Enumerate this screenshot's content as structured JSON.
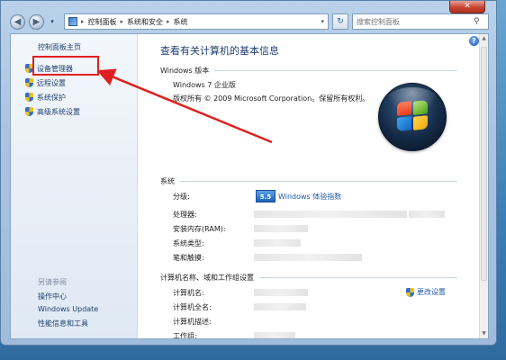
{
  "window": {
    "close_glyph": "✕"
  },
  "nav": {
    "back_glyph": "◀",
    "forward_glyph": "▶",
    "dropdown_glyph": "▾",
    "breadcrumb": [
      "控制面板",
      "系统和安全",
      "系统"
    ],
    "separator_glyph": "▸",
    "address_chevron": "▾",
    "refresh_glyph": "↻",
    "search_placeholder": "搜索控制面板",
    "search_icon_glyph": "⚲"
  },
  "sidebar": {
    "home": "控制面板主页",
    "items": [
      {
        "label": "设备管理器",
        "icon": "shield-icon"
      },
      {
        "label": "远程设置",
        "icon": "shield-icon"
      },
      {
        "label": "系统保护",
        "icon": "shield-icon"
      },
      {
        "label": "高级系统设置",
        "icon": "shield-icon"
      }
    ],
    "see_also": "另请参阅",
    "see_also_items": [
      "操作中心",
      "Windows Update",
      "性能信息和工具"
    ]
  },
  "main": {
    "help_glyph": "?",
    "title": "查看有关计算机的基本信息",
    "edition_section": "Windows 版本",
    "edition": "Windows 7 企业版",
    "copyright": "版权所有 © 2009 Microsoft Corporation。保留所有权利。",
    "system_section": "系统",
    "system_rows": [
      "分级:",
      "处理器:",
      "安装内存(RAM):",
      "系统类型:",
      "笔和触摸:"
    ],
    "rating_score": "5.5",
    "rating_link": "Windows 体验指数",
    "name_section": "计算机名称、域和工作组设置",
    "name_rows": [
      "计算机名:",
      "计算机全名:",
      "计算机描述:",
      "工作组:"
    ],
    "change_settings": "更改设置"
  },
  "colors": {
    "accent_link": "#1a5aa8",
    "annotation_red": "#e02020"
  }
}
